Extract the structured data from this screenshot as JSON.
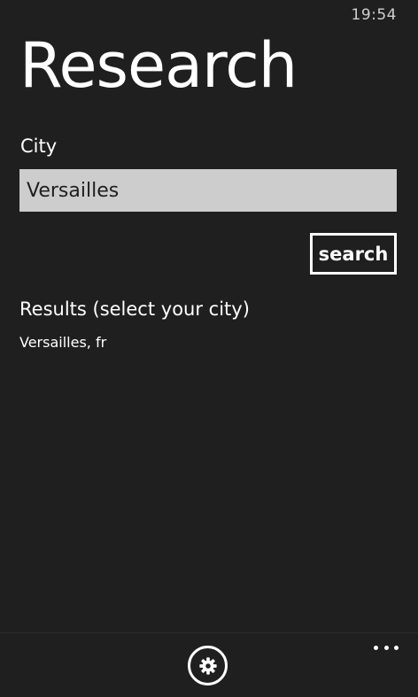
{
  "status_bar": {
    "time": "19:54"
  },
  "page": {
    "title": "Research"
  },
  "form": {
    "city_label": "City",
    "city_value": "Versailles",
    "search_label": "search"
  },
  "results": {
    "header": "Results (select your city)",
    "items": [
      {
        "label": "Versailles, fr"
      }
    ]
  },
  "app_bar": {
    "settings_icon": "gear-icon",
    "more_icon": "ellipsis-icon"
  }
}
